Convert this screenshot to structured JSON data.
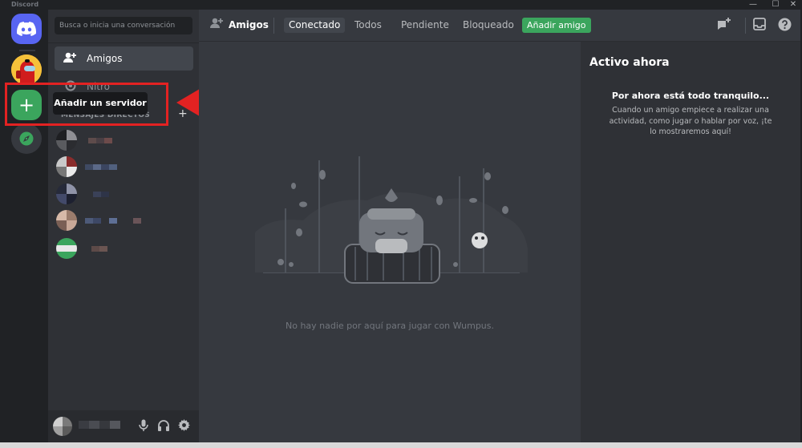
{
  "window": {
    "title": "Discord",
    "controls": {
      "minimize": "—",
      "maximize": "☐",
      "close": "✕"
    }
  },
  "servers": {
    "home_icon": "discord-logo-icon",
    "avatar_icon": "among-us-avatar",
    "add_label": "+",
    "explore_icon": "compass-icon"
  },
  "tooltip": {
    "label": "Añadir un servidor"
  },
  "sidebar": {
    "search_placeholder": "Busca o inicia una conversación",
    "friends_label": "Amigos",
    "nitro_label": "Nitro",
    "dm_header": "MENSAJES DIRECTOS",
    "dm_add": "+"
  },
  "topbar": {
    "title": "Amigos",
    "tabs": [
      {
        "label": "Conectado",
        "active": true
      },
      {
        "label": "Todos"
      },
      {
        "label": "Pendiente"
      },
      {
        "label": "Bloqueado"
      }
    ],
    "add_friend_label": "Añadir amigo"
  },
  "main": {
    "empty_text": "No hay nadie por aquí para jugar con Wumpus."
  },
  "active_now": {
    "title": "Activo ahora",
    "subtitle": "Por ahora está todo tranquilo...",
    "description": "Cuando un amigo empiece a realizar una actividad, como jugar o hablar por voz, ¡te lo mostraremos aquí!"
  },
  "colors": {
    "accent": "#5865f2",
    "green": "#3ba55d",
    "highlight": "#e32222"
  }
}
